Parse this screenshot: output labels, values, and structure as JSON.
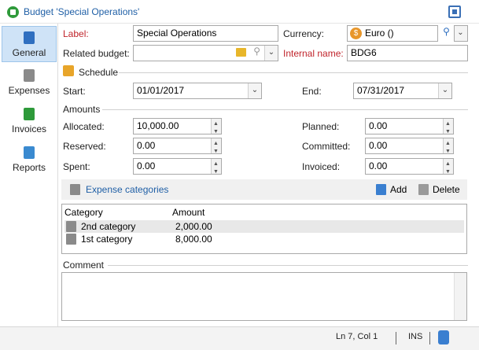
{
  "window": {
    "title": "Budget 'Special Operations'"
  },
  "sidebar": {
    "items": [
      {
        "label": "General"
      },
      {
        "label": "Expenses"
      },
      {
        "label": "Invoices"
      },
      {
        "label": "Reports"
      }
    ]
  },
  "form": {
    "label_caption": "Label:",
    "label_value": "Special Operations",
    "currency_caption": "Currency:",
    "currency_value": "Euro ()",
    "related_budget_caption": "Related budget:",
    "related_budget_value": "",
    "internal_name_caption": "Internal name:",
    "internal_name_value": "BDG6"
  },
  "schedule": {
    "section_title": "Schedule",
    "start_caption": "Start:",
    "start_value": "01/01/2017",
    "end_caption": "End:",
    "end_value": "07/31/2017"
  },
  "amounts": {
    "section_title": "Amounts",
    "allocated_caption": "Allocated:",
    "allocated_value": "10,000.00",
    "reserved_caption": "Reserved:",
    "reserved_value": "0.00",
    "spent_caption": "Spent:",
    "spent_value": "0.00",
    "planned_caption": "Planned:",
    "planned_value": "0.00",
    "committed_caption": "Committed:",
    "committed_value": "0.00",
    "invoiced_caption": "Invoiced:",
    "invoiced_value": "0.00"
  },
  "expense_categories": {
    "title": "Expense categories",
    "add_label": "Add",
    "delete_label": "Delete",
    "columns": [
      "Category",
      "Amount"
    ],
    "rows": [
      {
        "category": "2nd category",
        "amount": "2,000.00"
      },
      {
        "category": "1st category",
        "amount": "8,000.00"
      }
    ]
  },
  "comment": {
    "caption": "Comment",
    "value": ""
  },
  "status": {
    "position": "Ln 7, Col 1",
    "mode": "INS"
  }
}
